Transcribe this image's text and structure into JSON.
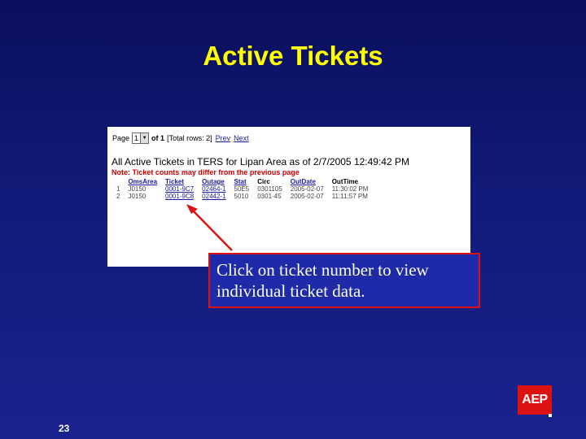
{
  "slide": {
    "title": "Active Tickets",
    "page_number": "23",
    "logo_text": "AEP"
  },
  "pager": {
    "page_label": "Page",
    "selected_page": "1",
    "of_text": "of 1",
    "total_rows_text": "[Total rows: 2]",
    "prev_label": "Prev",
    "next_label": "Next"
  },
  "report": {
    "heading": "All Active Tickets in TERS for Lipan Area as of 2/7/2005 12:49:42 PM",
    "note": "Note: Ticket counts may differ from the previous page",
    "columns": [
      "",
      "OmsArea",
      "Ticket",
      "Outage",
      "Stat",
      "Circ",
      "OutDate",
      "OutTime"
    ],
    "rows": [
      [
        "1",
        "J0150",
        "0001-9C7",
        "02464-1",
        "50E5",
        "0301105",
        "2005-02-07",
        "11:30:02 PM"
      ],
      [
        "2",
        "J0150",
        "0001-9C8",
        "02442-1",
        "5010",
        "0301-45",
        "2005-02-07",
        "11:11:57 PM"
      ]
    ]
  },
  "callout": {
    "text": "Click on ticket number to view individual ticket data."
  },
  "colors": {
    "background": "#121a78",
    "title": "#ffff00",
    "callout_border": "#dd1111",
    "arrow": "#dd1111",
    "link": "#1a1aa0",
    "note": "#cc0000"
  }
}
